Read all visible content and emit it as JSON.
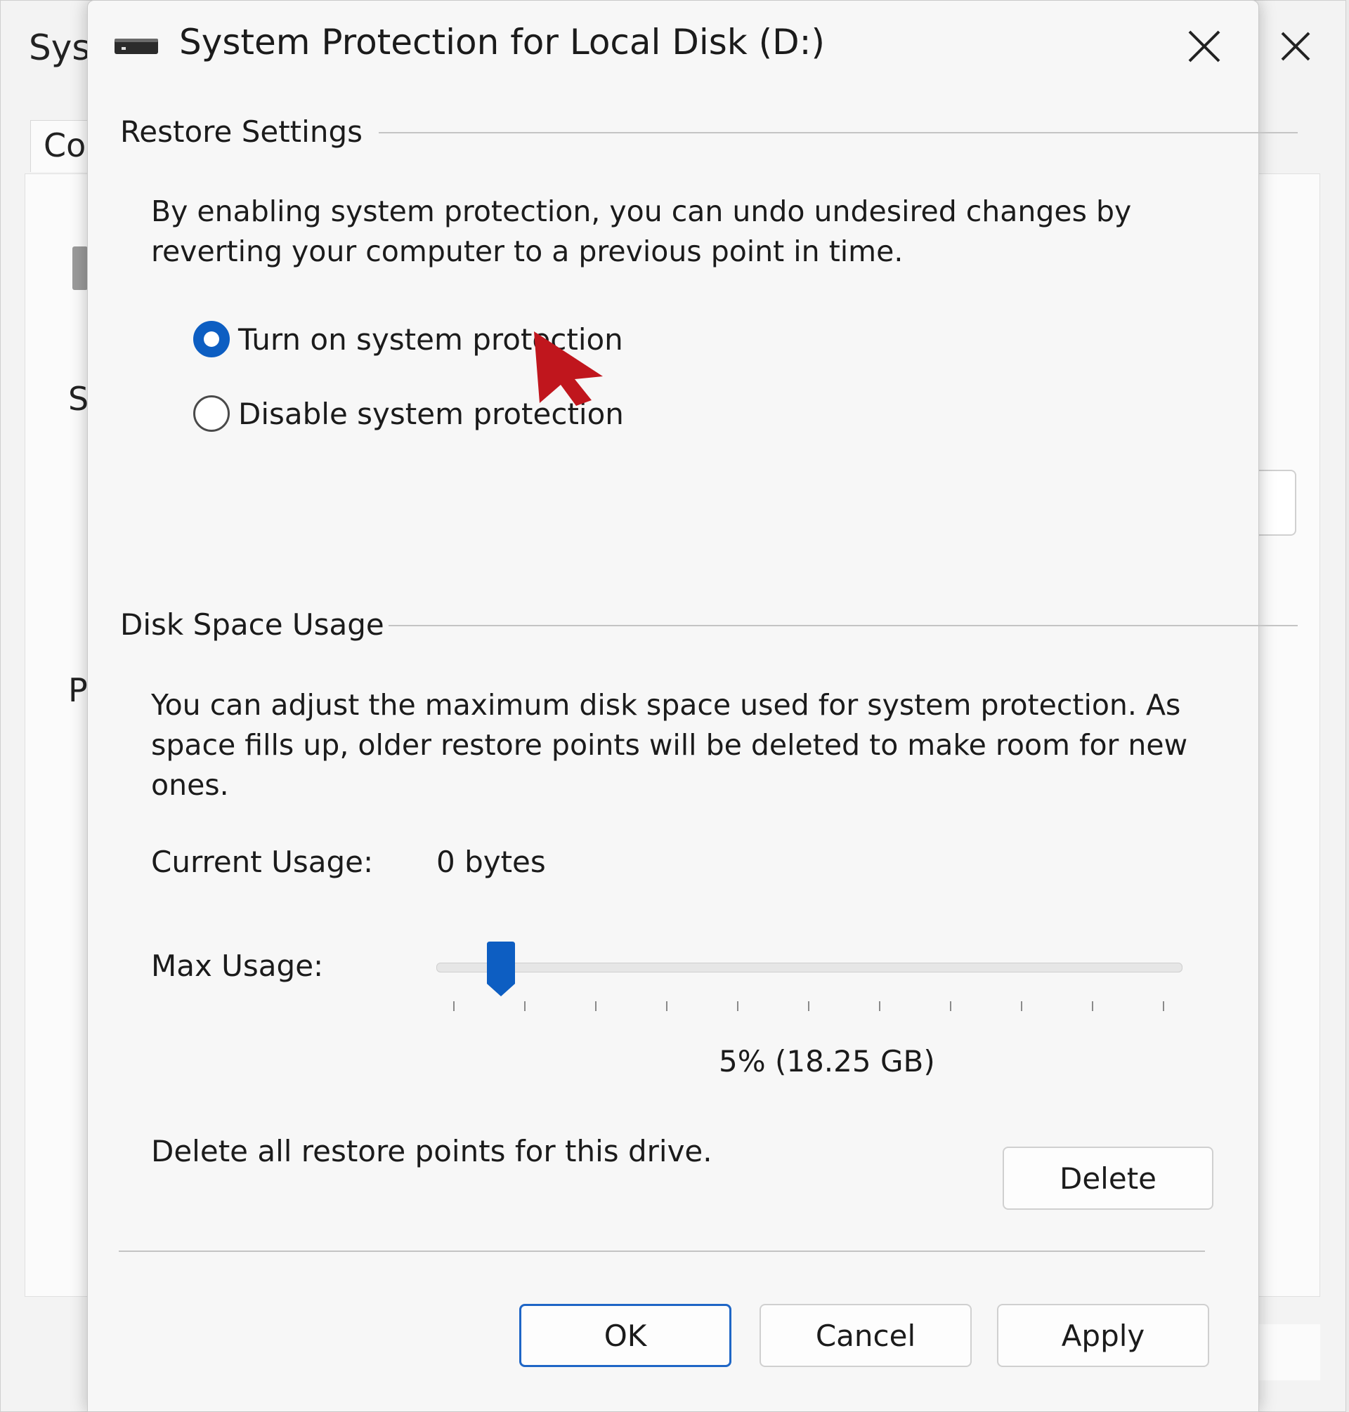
{
  "background_window": {
    "title_partial": "Syst",
    "tab_partial": "Co",
    "letters": [
      "S",
      "P"
    ]
  },
  "dialog": {
    "title": "System Protection for Local Disk (D:)",
    "restore_settings": {
      "label": "Restore Settings",
      "description": "By enabling system protection, you can undo undesired changes by reverting your computer to a previous point in time.",
      "options": [
        {
          "label": "Turn on system protection",
          "selected": true
        },
        {
          "label": "Disable system protection",
          "selected": false
        }
      ]
    },
    "disk_space": {
      "label": "Disk Space Usage",
      "description": "You can adjust the maximum disk space used for system protection. As space fills up, older restore points will be deleted to make room for new ones.",
      "current_usage_label": "Current Usage:",
      "current_usage_value": "0 bytes",
      "max_usage_label": "Max Usage:",
      "max_usage_percent": 5,
      "max_usage_value": "5% (18.25 GB)",
      "delete_text": "Delete all restore points for this drive.",
      "delete_button": "Delete"
    },
    "buttons": {
      "ok": "OK",
      "cancel": "Cancel",
      "apply": "Apply"
    }
  },
  "colors": {
    "accent": "#0d5ec2",
    "cursor": "#c0161d"
  },
  "icons": {
    "drive": "drive-icon",
    "close": "close-icon",
    "cursor": "mouse-pointer-icon"
  }
}
